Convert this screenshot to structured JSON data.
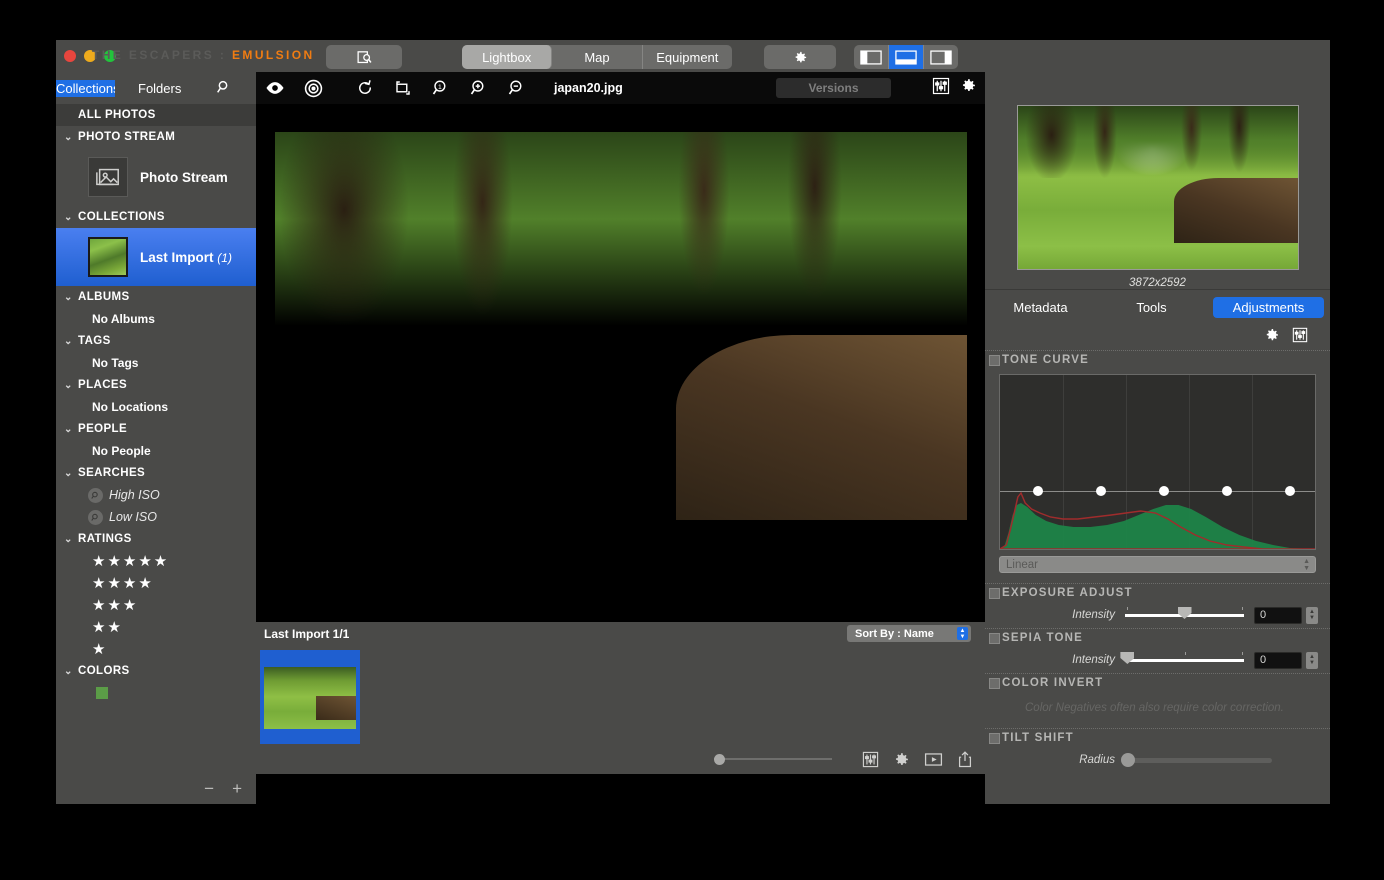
{
  "window": {
    "title_prefix": "THE ESCAPERS : ",
    "title_brand": "EMULSION"
  },
  "toolbar": {
    "camera_icon": "camera-import-icon",
    "modes": [
      {
        "label": "Lightbox",
        "active": true
      },
      {
        "label": "Map",
        "active": false
      },
      {
        "label": "Equipment",
        "active": false
      }
    ],
    "gear_icon": "gear-icon",
    "layout_views": [
      {
        "name": "layout-left-panel-icon",
        "active": false
      },
      {
        "name": "layout-filmstrip-icon",
        "active": true
      },
      {
        "name": "layout-right-panel-icon",
        "active": false
      }
    ]
  },
  "sidebar": {
    "tabs": [
      {
        "label": "Collections",
        "selected": true
      },
      {
        "label": "Folders",
        "selected": false
      }
    ],
    "search_icon": "search-icon",
    "all_photos": "ALL PHOTOS",
    "groups": [
      {
        "title": "PHOTO STREAM",
        "type": "thumb",
        "item": {
          "label": "Photo Stream",
          "selected": false
        }
      },
      {
        "title": "COLLECTIONS",
        "type": "thumb",
        "item": {
          "label": "Last Import",
          "count": "(1)",
          "selected": true
        }
      },
      {
        "title": "ALBUMS",
        "type": "text",
        "items": [
          "No Albums"
        ]
      },
      {
        "title": "TAGS",
        "type": "text",
        "items": [
          "No Tags"
        ]
      },
      {
        "title": "PLACES",
        "type": "text",
        "items": [
          "No Locations"
        ]
      },
      {
        "title": "PEOPLE",
        "type": "text",
        "items": [
          "No People"
        ]
      },
      {
        "title": "SEARCHES",
        "type": "search",
        "items": [
          "High ISO",
          "Low ISO"
        ]
      },
      {
        "title": "RATINGS",
        "type": "stars",
        "items": [
          "★★★★★",
          "★★★★",
          "★★★",
          "★★",
          "★"
        ]
      },
      {
        "title": "COLORS",
        "type": "color",
        "swatch": "#5b9c47"
      }
    ],
    "footer": {
      "remove_label": "−",
      "add_label": "+"
    }
  },
  "image_toolbar": {
    "icons": [
      "eye-icon",
      "target-focus-icon",
      "rotate-icon",
      "crop-icon",
      "zoom-actual-icon",
      "zoom-in-icon",
      "zoom-out-icon"
    ],
    "filename": "japan20.jpg",
    "versions_label": "Versions",
    "right_icons": [
      "sliders-icon",
      "gear-icon"
    ]
  },
  "filmstrip": {
    "title": "Last Import 1/1",
    "sort_label": "Sort By : Name",
    "footer_icons": [
      "sliders-icon",
      "gear-icon",
      "slideshow-play-icon",
      "share-icon"
    ],
    "zoom_value": 0
  },
  "right_panel": {
    "dimensions": "3872x2592",
    "tabs": [
      {
        "label": "Metadata",
        "active": false
      },
      {
        "label": "Tools",
        "active": false
      },
      {
        "label": "Adjustments",
        "active": true
      }
    ],
    "panel_icons": [
      "gear-icon",
      "sliders-icon"
    ],
    "sections": [
      {
        "title": "TONE CURVE",
        "enabled": false,
        "curve_mode": "Linear",
        "points": [
          12,
          32,
          52,
          72,
          92
        ]
      },
      {
        "title": "EXPOSURE ADJUST",
        "enabled": false,
        "slider_label": "Intensity",
        "value": "0",
        "thumb_pct": 50
      },
      {
        "title": "SEPIA TONE",
        "enabled": false,
        "slider_label": "Intensity",
        "value": "0",
        "thumb_pct": 2
      },
      {
        "title": "COLOR INVERT",
        "enabled": false,
        "note": "Color Negatives often also require color correction."
      },
      {
        "title": "TILT SHIFT",
        "enabled": false,
        "slider_label": "Radius",
        "thumb_pct": 2
      }
    ]
  },
  "colors": {
    "accent_blue": "#1f6fe5",
    "brand_orange": "#f07c12",
    "panel_gray": "#4a4a48"
  }
}
